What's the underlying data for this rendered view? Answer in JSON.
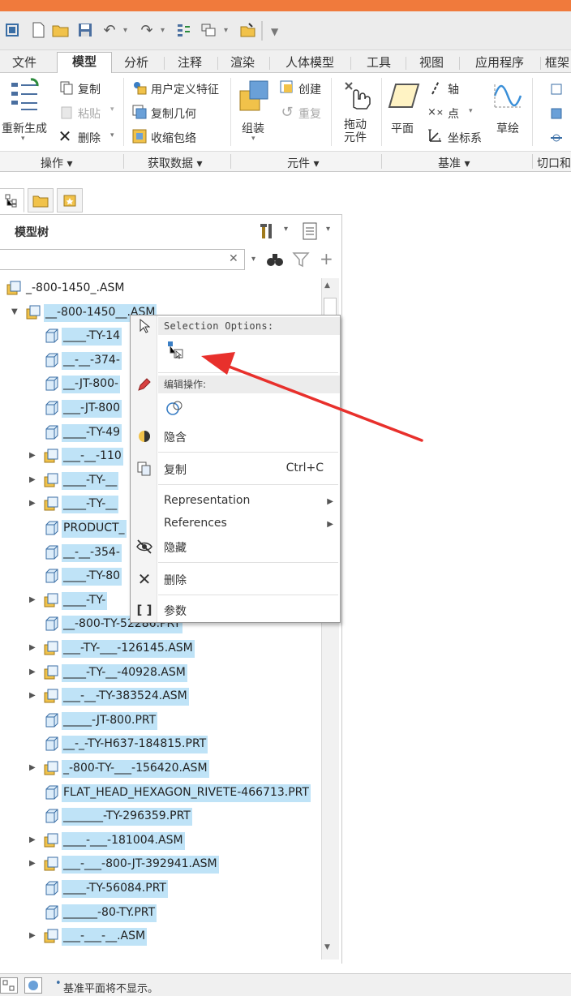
{
  "ribbon_tabs": [
    "文件",
    "模型",
    "分析",
    "注释",
    "渲染",
    "人体模型",
    "工具",
    "视图",
    "应用程序",
    "框架"
  ],
  "active_tab": "模型",
  "ribbon": {
    "regenerate": "重新生成",
    "copy": "复制",
    "paste": "粘贴",
    "delete": "删除",
    "user_feature": "用户定义特征",
    "copy_geometry": "复制几何",
    "shrinkwrap": "收缩包络",
    "assemble": "组装",
    "create": "创建",
    "repeat": "重复",
    "drag_components_1": "拖动",
    "drag_components_2": "元件",
    "plane": "平面",
    "axis": "轴",
    "point": "点",
    "coord_sys": "坐标系",
    "sketch": "草绘"
  },
  "groups": [
    "操作",
    "获取数据",
    "元件",
    "基准",
    "切口和"
  ],
  "tree": {
    "title": "模型树",
    "search_value": "",
    "rows": [
      {
        "label": "_-800-1450_.ASM",
        "type": "asm",
        "level": 0,
        "expander": "",
        "selected": false
      },
      {
        "label": "__-800-1450__.ASM",
        "type": "asm",
        "level": 1,
        "expander": "▼",
        "selected": true
      },
      {
        "label": "____-TY-14",
        "type": "prt",
        "level": 2,
        "expander": "",
        "selected": true
      },
      {
        "label": "__-__-374-",
        "type": "prt",
        "level": 2,
        "expander": "",
        "selected": true
      },
      {
        "label": "__-JT-800-",
        "type": "prt",
        "level": 2,
        "expander": "",
        "selected": true
      },
      {
        "label": "___-JT-800",
        "type": "prt",
        "level": 2,
        "expander": "",
        "selected": true
      },
      {
        "label": "____-TY-49",
        "type": "prt",
        "level": 2,
        "expander": "",
        "selected": true
      },
      {
        "label": "___-__-110",
        "type": "asm",
        "level": 2,
        "expander": "▶",
        "selected": true
      },
      {
        "label": "____-TY-__",
        "type": "asm",
        "level": 2,
        "expander": "▶",
        "selected": true
      },
      {
        "label": "____-TY-__",
        "type": "asm",
        "level": 2,
        "expander": "▶",
        "selected": true
      },
      {
        "label": "PRODUCT_",
        "type": "prt",
        "level": 2,
        "expander": "",
        "selected": true
      },
      {
        "label": "__-__-354-",
        "type": "prt",
        "level": 2,
        "expander": "",
        "selected": true
      },
      {
        "label": "____-TY-80",
        "type": "prt",
        "level": 2,
        "expander": "",
        "selected": true
      },
      {
        "label": "____-TY-",
        "type": "asm",
        "level": 2,
        "expander": "▶",
        "selected": true
      },
      {
        "label": "__-800-TY-52286.PRT",
        "type": "prt",
        "level": 2,
        "expander": "",
        "selected": true
      },
      {
        "label": "___-TY-___-126145.ASM",
        "type": "asm",
        "level": 2,
        "expander": "▶",
        "selected": true
      },
      {
        "label": "____-TY-__-40928.ASM",
        "type": "asm",
        "level": 2,
        "expander": "▶",
        "selected": true
      },
      {
        "label": "___-__-TY-383524.ASM",
        "type": "asm",
        "level": 2,
        "expander": "▶",
        "selected": true
      },
      {
        "label": "_____-JT-800.PRT",
        "type": "prt",
        "level": 2,
        "expander": "",
        "selected": true
      },
      {
        "label": "__-_-TY-H637-184815.PRT",
        "type": "prt",
        "level": 2,
        "expander": "",
        "selected": true
      },
      {
        "label": "_-800-TY-___-156420.ASM",
        "type": "asm",
        "level": 2,
        "expander": "▶",
        "selected": true
      },
      {
        "label": "FLAT_HEAD_HEXAGON_RIVETE-466713.PRT",
        "type": "prt",
        "level": 2,
        "expander": "",
        "selected": true
      },
      {
        "label": "_______-TY-296359.PRT",
        "type": "prt",
        "level": 2,
        "expander": "",
        "selected": true
      },
      {
        "label": "____-___-181004.ASM",
        "type": "asm",
        "level": 2,
        "expander": "▶",
        "selected": true
      },
      {
        "label": "___-___-800-JT-392941.ASM",
        "type": "asm",
        "level": 2,
        "expander": "▶",
        "selected": true
      },
      {
        "label": "____-TY-56084.PRT",
        "type": "prt",
        "level": 2,
        "expander": "",
        "selected": true
      },
      {
        "label": "______-80-TY.PRT",
        "type": "prt",
        "level": 2,
        "expander": "",
        "selected": true
      },
      {
        "label": "___-___-__.ASM",
        "type": "asm",
        "level": 2,
        "expander": "▶",
        "selected": true
      }
    ]
  },
  "context_menu": {
    "selection_header": "Selection Options:",
    "edit_header": "编辑操作:",
    "items": {
      "hide_implicit": "隐含",
      "copy": "复制",
      "copy_shortcut": "Ctrl+C",
      "representation": "Representation",
      "references": "References",
      "hide": "隐藏",
      "delete": "删除",
      "params": "参数"
    }
  },
  "status": {
    "message": "基准平面将不显示。"
  },
  "colors": {
    "selection": "#bfe3f7",
    "accent_arrow": "#e8302c",
    "title_stripe": "#f07a3c"
  }
}
